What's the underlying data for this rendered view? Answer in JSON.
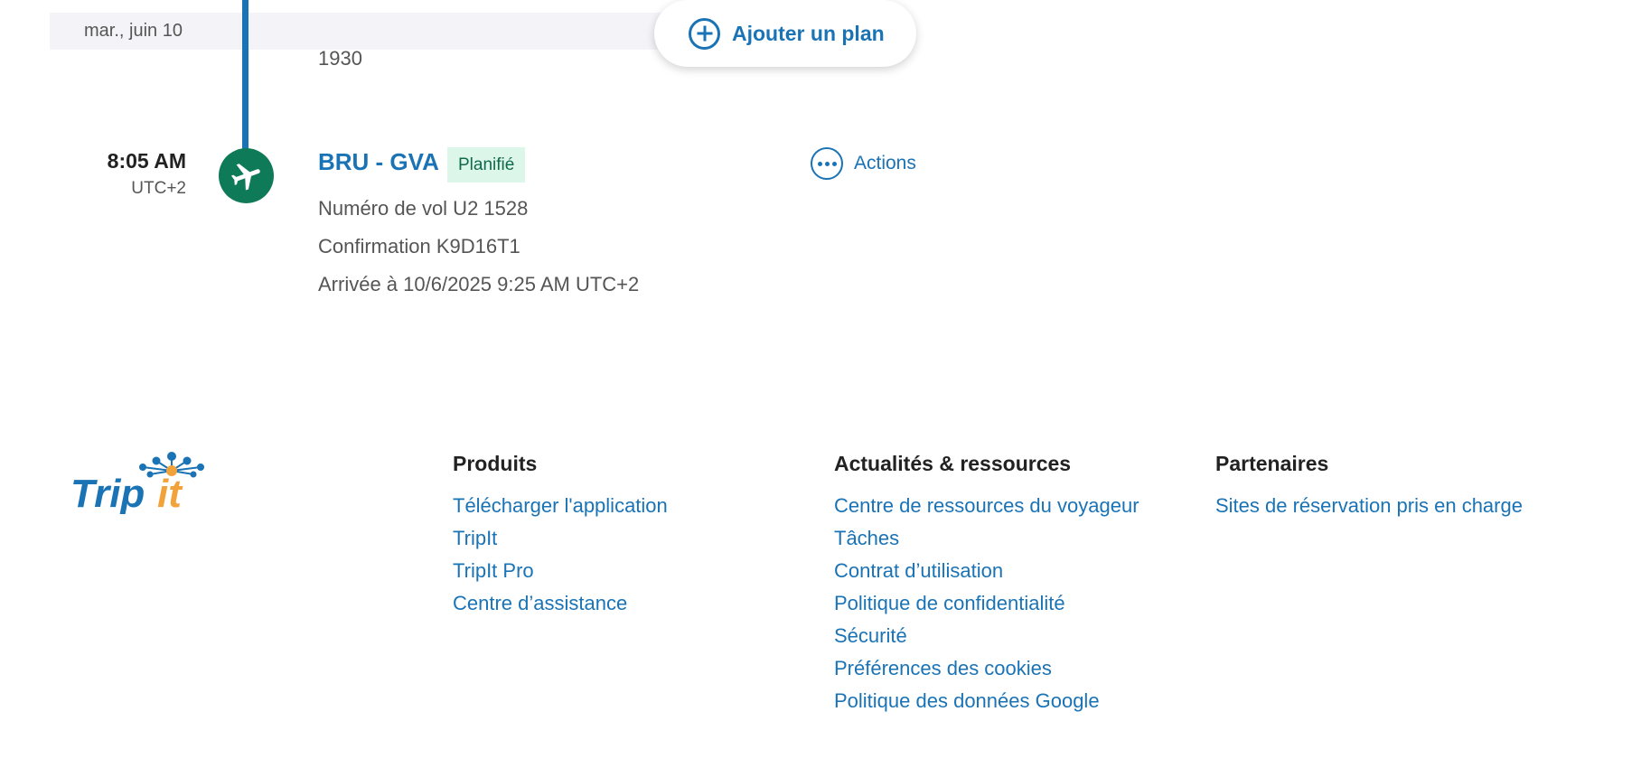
{
  "date_bar": {
    "date": "mar., juin 10"
  },
  "add_plan": {
    "label": "Ajouter un plan"
  },
  "previous_segment": {
    "text": "1930"
  },
  "segment": {
    "time": "8:05 AM",
    "timezone": "UTC+2",
    "icon": "airplane-icon",
    "title": "BRU - GVA",
    "status": "Planifié",
    "actions_label": "Actions",
    "flight_number": "Numéro de vol U2 1528",
    "confirmation": "Confirmation K9D16T1",
    "arrival": "Arrivée à 10/6/2025 9:25 AM UTC+2"
  },
  "footer": {
    "logo": "TripIt",
    "columns": [
      {
        "heading": "Produits",
        "links": [
          "Télécharger l'application",
          "TripIt",
          "TripIt Pro",
          "Centre d’assistance"
        ]
      },
      {
        "heading": "Actualités & ressources",
        "links": [
          "Centre de ressources du voyageur",
          "Tâches",
          "Contrat d’utilisation",
          "Politique de confidentialité",
          "Sécurité",
          "Préférences des cookies",
          "Politique des données Google"
        ]
      },
      {
        "heading": "Partenaires",
        "links": [
          "Sites de réservation pris en charge"
        ]
      }
    ]
  },
  "colors": {
    "accent": "#1a73b5",
    "flight_icon_bg": "#0f7a58",
    "status_bg": "#ddf6ea",
    "logo_orange": "#f2a23a"
  }
}
